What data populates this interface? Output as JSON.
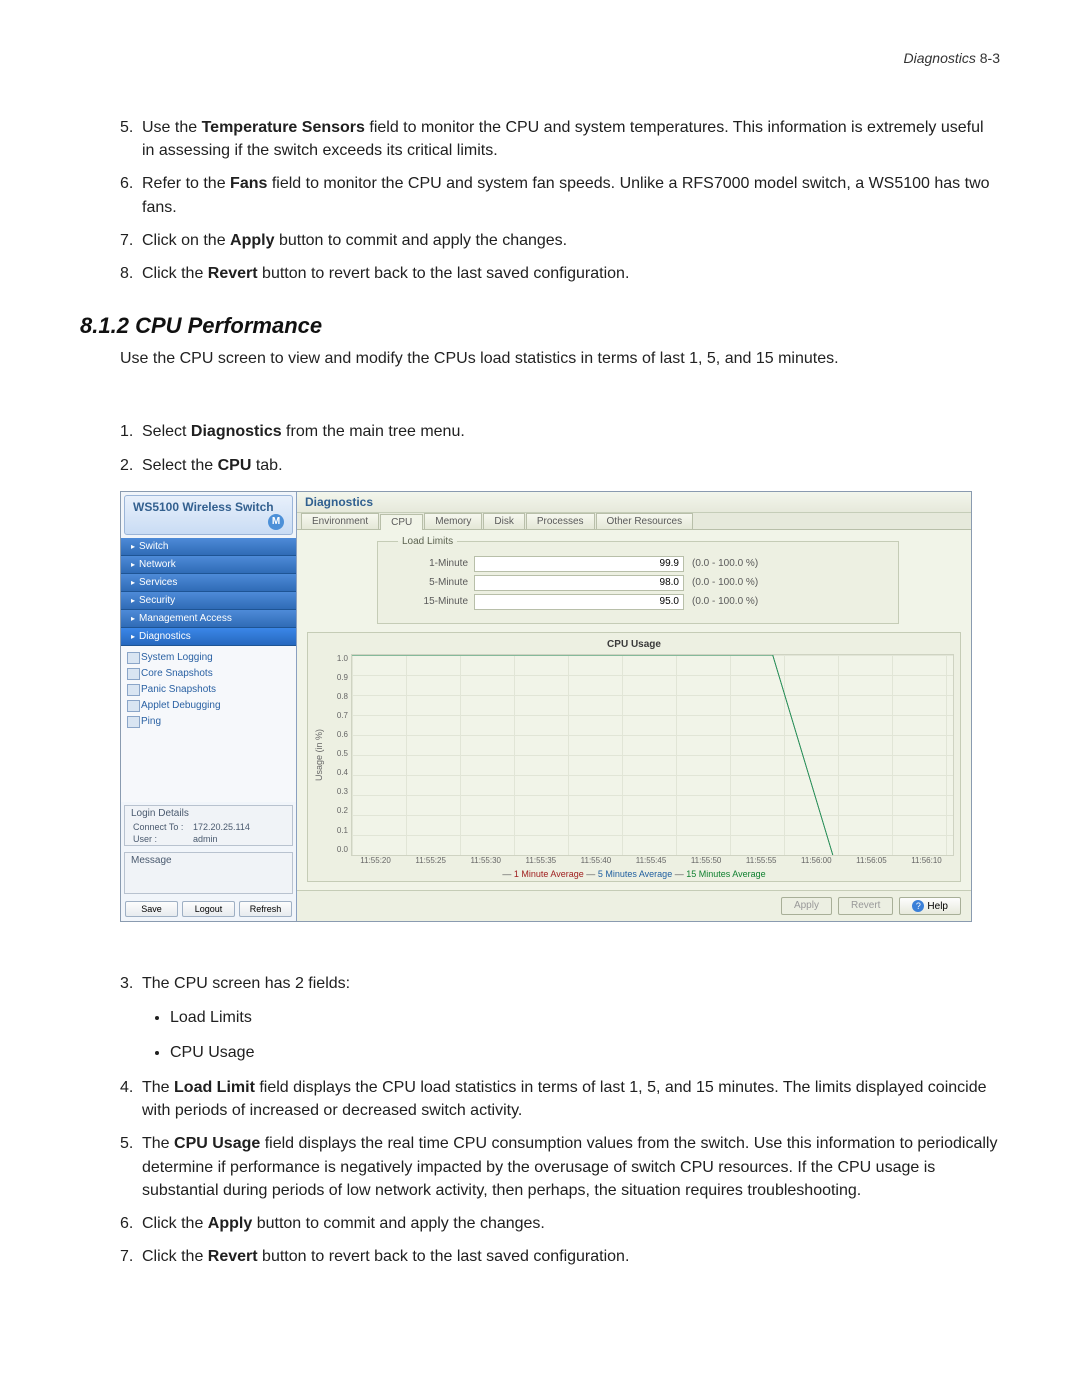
{
  "header": {
    "section": "Diagnostics",
    "page": "8-3"
  },
  "steps_top": [
    {
      "n": "5.",
      "pre": "Use the ",
      "bold": "Temperature Sensors",
      "post": " field to monitor the CPU and system temperatures. This information is extremely useful in assessing if the switch exceeds its critical limits."
    },
    {
      "n": "6.",
      "pre": "Refer to the ",
      "bold": "Fans",
      "post": " field to monitor the CPU and system fan speeds. Unlike a RFS7000 model switch, a WS5100 has two fans."
    },
    {
      "n": "7.",
      "pre": "Click on the ",
      "bold": "Apply",
      "post": " button to commit and apply the changes."
    },
    {
      "n": "8.",
      "pre": "Click the ",
      "bold": "Revert",
      "post": " button to revert back to the last saved configuration."
    }
  ],
  "section_number": "8.1.2",
  "section_title": "CPU Performance",
  "intro_pre": "Use the ",
  "intro_bold": "CPU",
  "intro_post": " screen to view and modify the CPUs load statistics in terms of last 1, 5, and 15 minutes.",
  "steps_mid": [
    {
      "n": "1.",
      "pre": "Select ",
      "bold": "Diagnostics",
      "post": " from the main tree menu."
    },
    {
      "n": "2.",
      "pre": "Select the ",
      "bold": "CPU",
      "post": " tab."
    }
  ],
  "app": {
    "title": "WS5100 Wireless Switch",
    "nav": [
      "Switch",
      "Network",
      "Services",
      "Security",
      "Management Access",
      "Diagnostics"
    ],
    "tree": [
      "System Logging",
      "Core Snapshots",
      "Panic Snapshots",
      "Applet Debugging",
      "Ping"
    ],
    "login": {
      "title": "Login Details",
      "connect_lbl": "Connect To :",
      "connect_val": "172.20.25.114",
      "user_lbl": "User :",
      "user_val": "admin"
    },
    "message_title": "Message",
    "bottom_btns": [
      "Save",
      "Logout",
      "Refresh"
    ],
    "content_title": "Diagnostics",
    "tabs": [
      "Environment",
      "CPU",
      "Memory",
      "Disk",
      "Processes",
      "Other Resources"
    ],
    "load_limits": {
      "legend": "Load Limits",
      "rows": [
        {
          "label": "1-Minute",
          "value": "99.9",
          "range": "(0.0 - 100.0 %)"
        },
        {
          "label": "5-Minute",
          "value": "98.0",
          "range": "(0.0 - 100.0 %)"
        },
        {
          "label": "15-Minute",
          "value": "95.0",
          "range": "(0.0 - 100.0 %)"
        }
      ]
    },
    "chart": {
      "title": "CPU Usage",
      "ylabel": "Usage (in %)",
      "legend": {
        "s1": "1 Minute Average",
        "s2": "5 Minutes Average",
        "s3": "15 Minutes Average"
      }
    },
    "footer_btns": {
      "apply": "Apply",
      "revert": "Revert",
      "help": "Help"
    }
  },
  "chart_data": {
    "type": "line",
    "title": "CPU Usage",
    "xlabel": "",
    "ylabel": "Usage (in %)",
    "ylim": [
      0.0,
      1.0
    ],
    "x": [
      "11:55:20",
      "11:55:25",
      "11:55:30",
      "11:55:35",
      "11:55:40",
      "11:55:45",
      "11:55:50",
      "11:55:55",
      "11:56:00",
      "11:56:05",
      "11:56:10"
    ],
    "y_ticks": [
      "1.0",
      "0.9",
      "0.8",
      "0.7",
      "0.6",
      "0.5",
      "0.4",
      "0.3",
      "0.2",
      "0.1",
      "0.0"
    ],
    "series": [
      {
        "name": "1 Minute Average",
        "color": "#a02020",
        "values": [
          1.0,
          1.0,
          1.0,
          1.0,
          1.0,
          1.0,
          1.0,
          1.0,
          0.0,
          null,
          null
        ]
      },
      {
        "name": "5 Minutes Average",
        "color": "#2060a0",
        "values": [
          1.0,
          1.0,
          1.0,
          1.0,
          1.0,
          1.0,
          1.0,
          1.0,
          0.0,
          null,
          null
        ]
      },
      {
        "name": "15 Minutes Average",
        "color": "#20a050",
        "values": [
          1.0,
          1.0,
          1.0,
          1.0,
          1.0,
          1.0,
          1.0,
          1.0,
          0.0,
          null,
          null
        ]
      }
    ]
  },
  "steps_bottom": [
    {
      "n": "3.",
      "text": "The CPU screen has 2 fields:"
    }
  ],
  "bullets": [
    "Load Limits",
    "CPU Usage"
  ],
  "steps_bottom2": [
    {
      "n": "4.",
      "pre": "The ",
      "bold": "Load Limit",
      "post": " field displays the CPU load statistics in terms of last 1, 5, and 15 minutes. The limits displayed coincide with periods of increased or decreased switch activity."
    },
    {
      "n": "5.",
      "pre": "The ",
      "bold": "CPU Usage",
      "post": " field displays the real time CPU consumption values from the switch. Use this information to periodically determine if performance is negatively impacted by the overusage of switch CPU resources. If the CPU usage is substantial during periods of low network activity, then perhaps, the situation requires troubleshooting."
    },
    {
      "n": "6.",
      "pre": "Click the ",
      "bold": "Apply",
      "post": " button to commit and apply the changes."
    },
    {
      "n": "7.",
      "pre": "Click the ",
      "bold": "Revert",
      "post": " button to revert back to the last saved configuration."
    }
  ]
}
